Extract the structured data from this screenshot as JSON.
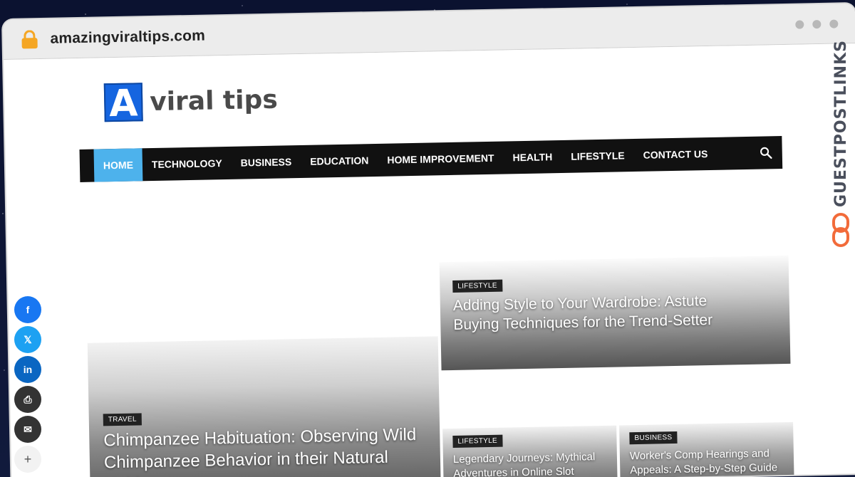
{
  "browser": {
    "url": "amazingviraltips.com"
  },
  "logo": {
    "letter": "A",
    "text": "viral tips"
  },
  "nav": {
    "items": [
      {
        "label": "HOME",
        "active": true
      },
      {
        "label": "TECHNOLOGY"
      },
      {
        "label": "BUSINESS"
      },
      {
        "label": "EDUCATION"
      },
      {
        "label": "HOME IMPROVEMENT"
      },
      {
        "label": "HEALTH"
      },
      {
        "label": "LIFESTYLE"
      },
      {
        "label": "CONTACT US"
      }
    ],
    "search_icon": "search-icon"
  },
  "posts": {
    "big": {
      "tag": "TRAVEL",
      "title": "Chimpanzee Habituation: Observing Wild Chimpanzee Behavior in their Natural Habitat"
    },
    "top_right": {
      "tag": "LIFESTYLE",
      "title": "Adding Style to Your Wardrobe: Astute Buying Techniques for the Trend-Setter"
    },
    "small1": {
      "tag": "LIFESTYLE",
      "title": "Legendary Journeys: Mythical Adventures in Online Slot"
    },
    "small2": {
      "tag": "BUSINESS",
      "title": "Worker's Comp Hearings and Appeals: A Step-by-Step Guide"
    }
  },
  "social": {
    "facebook": "f",
    "x": "𝕏",
    "linkedin": "in",
    "print": "⎙",
    "email": "✉",
    "more": "+"
  },
  "watermark": {
    "text": "GUESTPOSTLINKS"
  },
  "colors": {
    "nav_bg": "#111111",
    "nav_active": "#4db2ec",
    "logo_blue": "#1565e0",
    "lock": "#f5a623"
  }
}
